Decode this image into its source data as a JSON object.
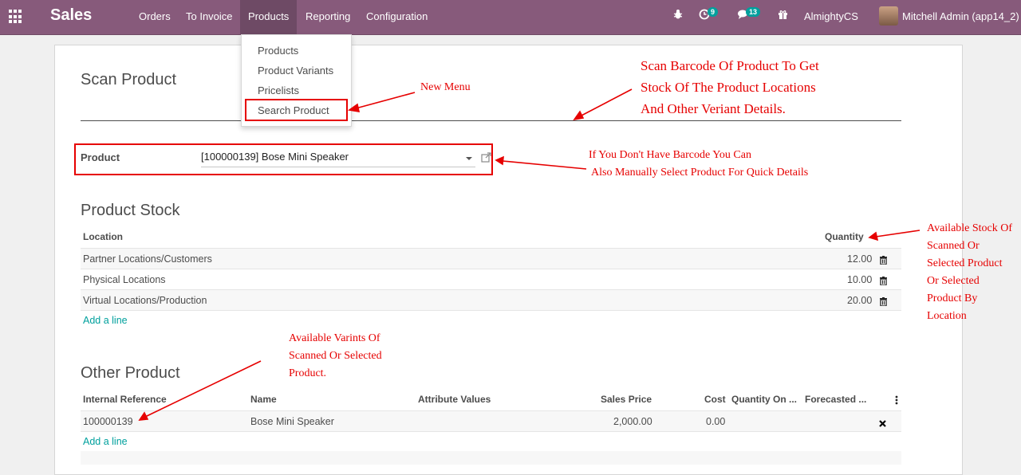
{
  "navbar": {
    "apps_icon": "grid-icon",
    "brand": "Sales",
    "menu": [
      "Orders",
      "To Invoice",
      "Products",
      "Reporting",
      "Configuration"
    ],
    "active_menu": "Products",
    "bug_icon": "bug-icon",
    "activity_icon": "clock-icon",
    "activity_count": "9",
    "chat_icon": "chat-icon",
    "chat_count": "13",
    "gift_icon": "gift-icon",
    "company": "AlmightyCS",
    "user": "Mitchell Admin (app14_2)"
  },
  "dropdown": {
    "items": [
      "Products",
      "Product Variants",
      "Pricelists",
      "Search Product"
    ],
    "highlighted": "Search Product"
  },
  "form": {
    "title": "Scan Product",
    "product_label": "Product",
    "product_value": "[100000139] Bose Mini Speaker",
    "external_link_icon": "external-link-icon"
  },
  "stock": {
    "title": "Product Stock",
    "columns": [
      "Location",
      "Quantity"
    ],
    "rows": [
      {
        "location": "Partner Locations/Customers",
        "quantity": "12.00"
      },
      {
        "location": "Physical Locations",
        "quantity": "10.00"
      },
      {
        "location": "Virtual Locations/Production",
        "quantity": "20.00"
      }
    ],
    "delete_icon": "trash-icon",
    "add_line": "Add a line"
  },
  "other": {
    "title": "Other Product",
    "columns": [
      "Internal Reference",
      "Name",
      "Attribute Values",
      "Sales Price",
      "Cost",
      "Quantity On ...",
      "Forecasted ..."
    ],
    "options_icon": "kebab-icon",
    "rows": [
      {
        "ref": "100000139",
        "name": "Bose Mini Speaker",
        "attributes": "",
        "price": "2,000.00",
        "cost": "0.00",
        "qty": "",
        "forecast": ""
      }
    ],
    "remove_icon": "close-icon",
    "add_line": "Add a line"
  },
  "annotations": {
    "new_menu": "New Menu",
    "scan_line1": "Scan Barcode Of Product To Get",
    "scan_line2": "Stock Of The Product Locations",
    "scan_line3": "And Other Veriant Details.",
    "manual_line1": "If You Don't Have Barcode You Can",
    "manual_line2": "Also Manually Select Product For Quick Details",
    "stock_lines": [
      "Available Stock Of",
      "Scanned Or",
      "Selected Product",
      "Or Selected",
      "Product By",
      "Location"
    ],
    "variant_lines": [
      "Available Varints Of",
      "Scanned Or Selected",
      "Product."
    ]
  },
  "colors": {
    "navbar": "#875a7b",
    "accent": "#00a09d",
    "annotation": "#e60000"
  }
}
